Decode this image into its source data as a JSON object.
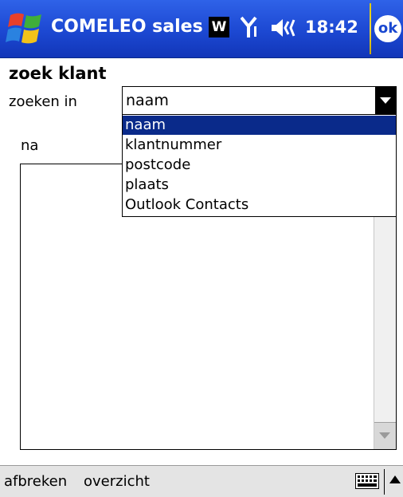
{
  "titlebar": {
    "app_title": "COMELEO sales",
    "w_icon_label": "W",
    "clock": "18:42",
    "ok_label": "ok",
    "icons": [
      "windows-start-icon",
      "signal-icon",
      "speaker-icon"
    ]
  },
  "form": {
    "heading": "zoek klant",
    "zoeken_label": "zoeken in",
    "na_label": "na"
  },
  "combobox": {
    "selected_value": "naam",
    "options": [
      {
        "label": "naam",
        "selected": true
      },
      {
        "label": "klantnummer",
        "selected": false
      },
      {
        "label": "postcode",
        "selected": false
      },
      {
        "label": "plaats",
        "selected": false
      },
      {
        "label": "Outlook Contacts",
        "selected": false
      }
    ]
  },
  "menubar": {
    "left_soft_key": "afbreken",
    "right_soft_key": "overzicht",
    "icons": [
      "keyboard-icon",
      "sip-up-arrow-icon"
    ]
  },
  "colors": {
    "titlebar_blue": "#1c48d2",
    "selection_navy": "#0a2a8a",
    "menubar_gray": "#e4e4e4"
  }
}
